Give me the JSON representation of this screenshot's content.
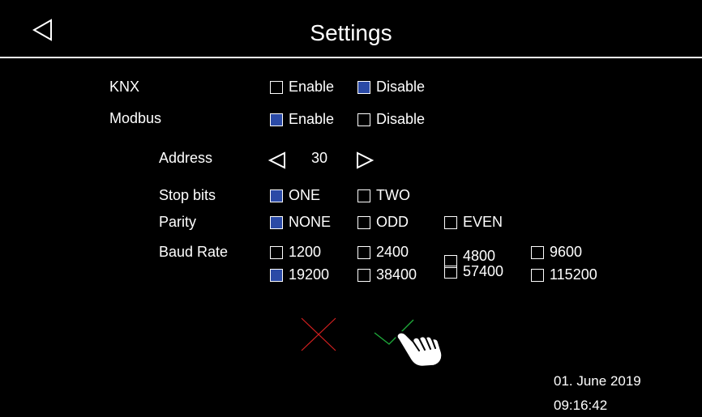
{
  "header": {
    "title": "Settings",
    "back_icon": "back-triangle-icon"
  },
  "knx": {
    "label": "KNX",
    "options": [
      {
        "label": "Enable",
        "checked": false
      },
      {
        "label": "Disable",
        "checked": true
      }
    ]
  },
  "modbus": {
    "label": "Modbus",
    "options": [
      {
        "label": "Enable",
        "checked": true
      },
      {
        "label": "Disable",
        "checked": false
      }
    ]
  },
  "address": {
    "label": "Address",
    "value": "30",
    "decrement_icon": "left-triangle-icon",
    "increment_icon": "right-triangle-icon"
  },
  "stop_bits": {
    "label": "Stop bits",
    "options": [
      {
        "label": "ONE",
        "checked": true
      },
      {
        "label": "TWO",
        "checked": false
      }
    ]
  },
  "parity": {
    "label": "Parity",
    "options": [
      {
        "label": "NONE",
        "checked": true
      },
      {
        "label": "ODD",
        "checked": false
      },
      {
        "label": "EVEN",
        "checked": false
      }
    ]
  },
  "baud_rate": {
    "label": "Baud Rate",
    "options": [
      {
        "label": "1200",
        "checked": false
      },
      {
        "label": "2400",
        "checked": false
      },
      {
        "label": "4800",
        "checked": false
      },
      {
        "label": "9600",
        "checked": false
      },
      {
        "label": "19200",
        "checked": true
      },
      {
        "label": "38400",
        "checked": false
      },
      {
        "label": "57400",
        "checked": false
      },
      {
        "label": "115200",
        "checked": false
      }
    ]
  },
  "actions": {
    "cancel_icon": "cancel-x-icon",
    "confirm_icon": "confirm-check-icon",
    "pointer_icon": "pointing-hand-icon"
  },
  "status": {
    "date": "01. June 2019",
    "time": "09:16:42"
  },
  "colors": {
    "background": "#000000",
    "checked": "#2b4aa6",
    "cancel": "#d42020",
    "confirm": "#1fa83a"
  }
}
